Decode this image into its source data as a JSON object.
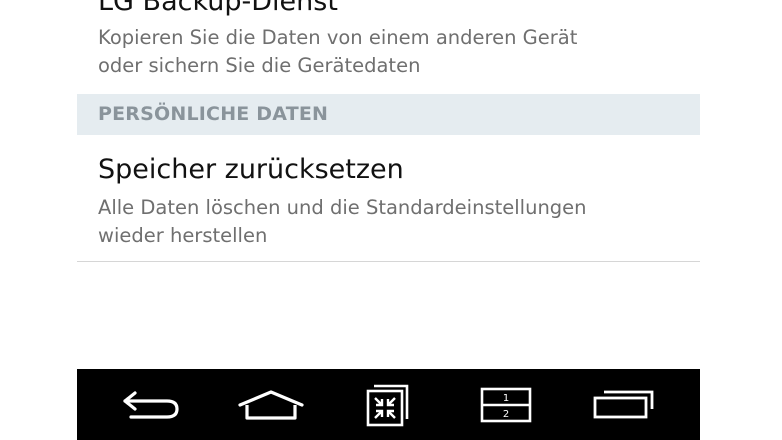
{
  "settings": {
    "backup": {
      "title": "LG Backup-Dienst",
      "desc_line1": "Kopieren Sie die Daten von einem anderen Gerät",
      "desc_line2": "oder sichern Sie die Gerätedaten"
    },
    "section_personal": "PERSÖNLICHE DATEN",
    "reset": {
      "title": "Speicher zurücksetzen",
      "desc_line1": "Alle Daten löschen und die Standardeinstellungen",
      "desc_line2": "wieder herstellen"
    }
  },
  "navbar": {
    "buttons": [
      {
        "icon": "back-icon"
      },
      {
        "icon": "home-icon"
      },
      {
        "icon": "dual-window-icon"
      },
      {
        "icon": "split-screen-icon"
      },
      {
        "icon": "recent-apps-icon"
      }
    ],
    "split_labels": [
      "1",
      "2"
    ],
    "colors": {
      "background": "#000000",
      "icon": "#ffffff"
    }
  }
}
